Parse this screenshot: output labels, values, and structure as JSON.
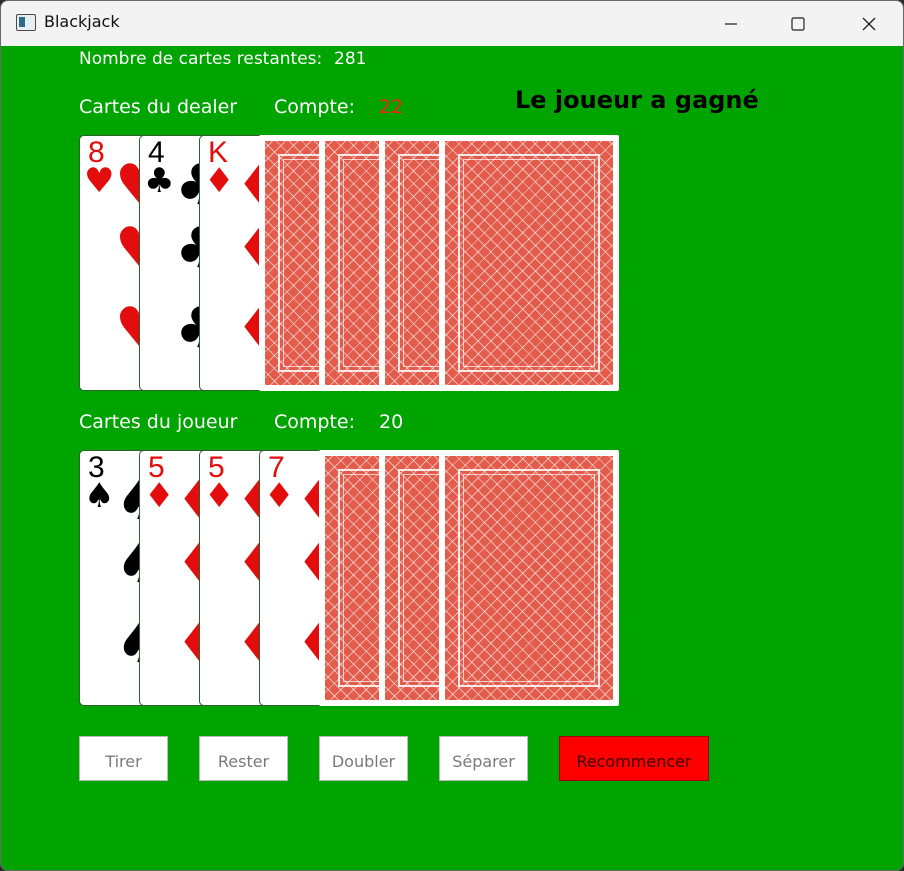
{
  "window": {
    "title": "Blackjack"
  },
  "info": {
    "remaining_label": "Nombre de cartes restantes:",
    "remaining_value": "281"
  },
  "dealer": {
    "label": "Cartes du dealer",
    "count_label": "Compte:",
    "count_value": "22",
    "cards": [
      {
        "rank": "8",
        "suit": "♥",
        "color": "red"
      },
      {
        "rank": "4",
        "suit": "♣",
        "color": "black"
      },
      {
        "rank": "K",
        "suit": "♦",
        "color": "red"
      },
      {
        "face_down": true
      },
      {
        "face_down": true
      },
      {
        "face_down": true
      },
      {
        "face_down": true
      }
    ]
  },
  "player": {
    "label": "Cartes du joueur",
    "count_label": "Compte:",
    "count_value": "20",
    "cards": [
      {
        "rank": "3",
        "suit": "♠",
        "color": "black"
      },
      {
        "rank": "5",
        "suit": "♦",
        "color": "red"
      },
      {
        "rank": "5",
        "suit": "♦",
        "color": "red"
      },
      {
        "rank": "7",
        "suit": "♦",
        "color": "red"
      },
      {
        "face_down": true
      },
      {
        "face_down": true
      },
      {
        "face_down": true
      }
    ]
  },
  "result": "Le joueur a gagné",
  "buttons": {
    "hit": "Tirer",
    "stand": "Rester",
    "double": "Doubler",
    "split": "Séparer",
    "restart": "Recommencer"
  },
  "colors": {
    "table": "#00a400",
    "bust": "#ff1a1a",
    "restart": "#ff0000",
    "card_back": "#e35b4a"
  }
}
